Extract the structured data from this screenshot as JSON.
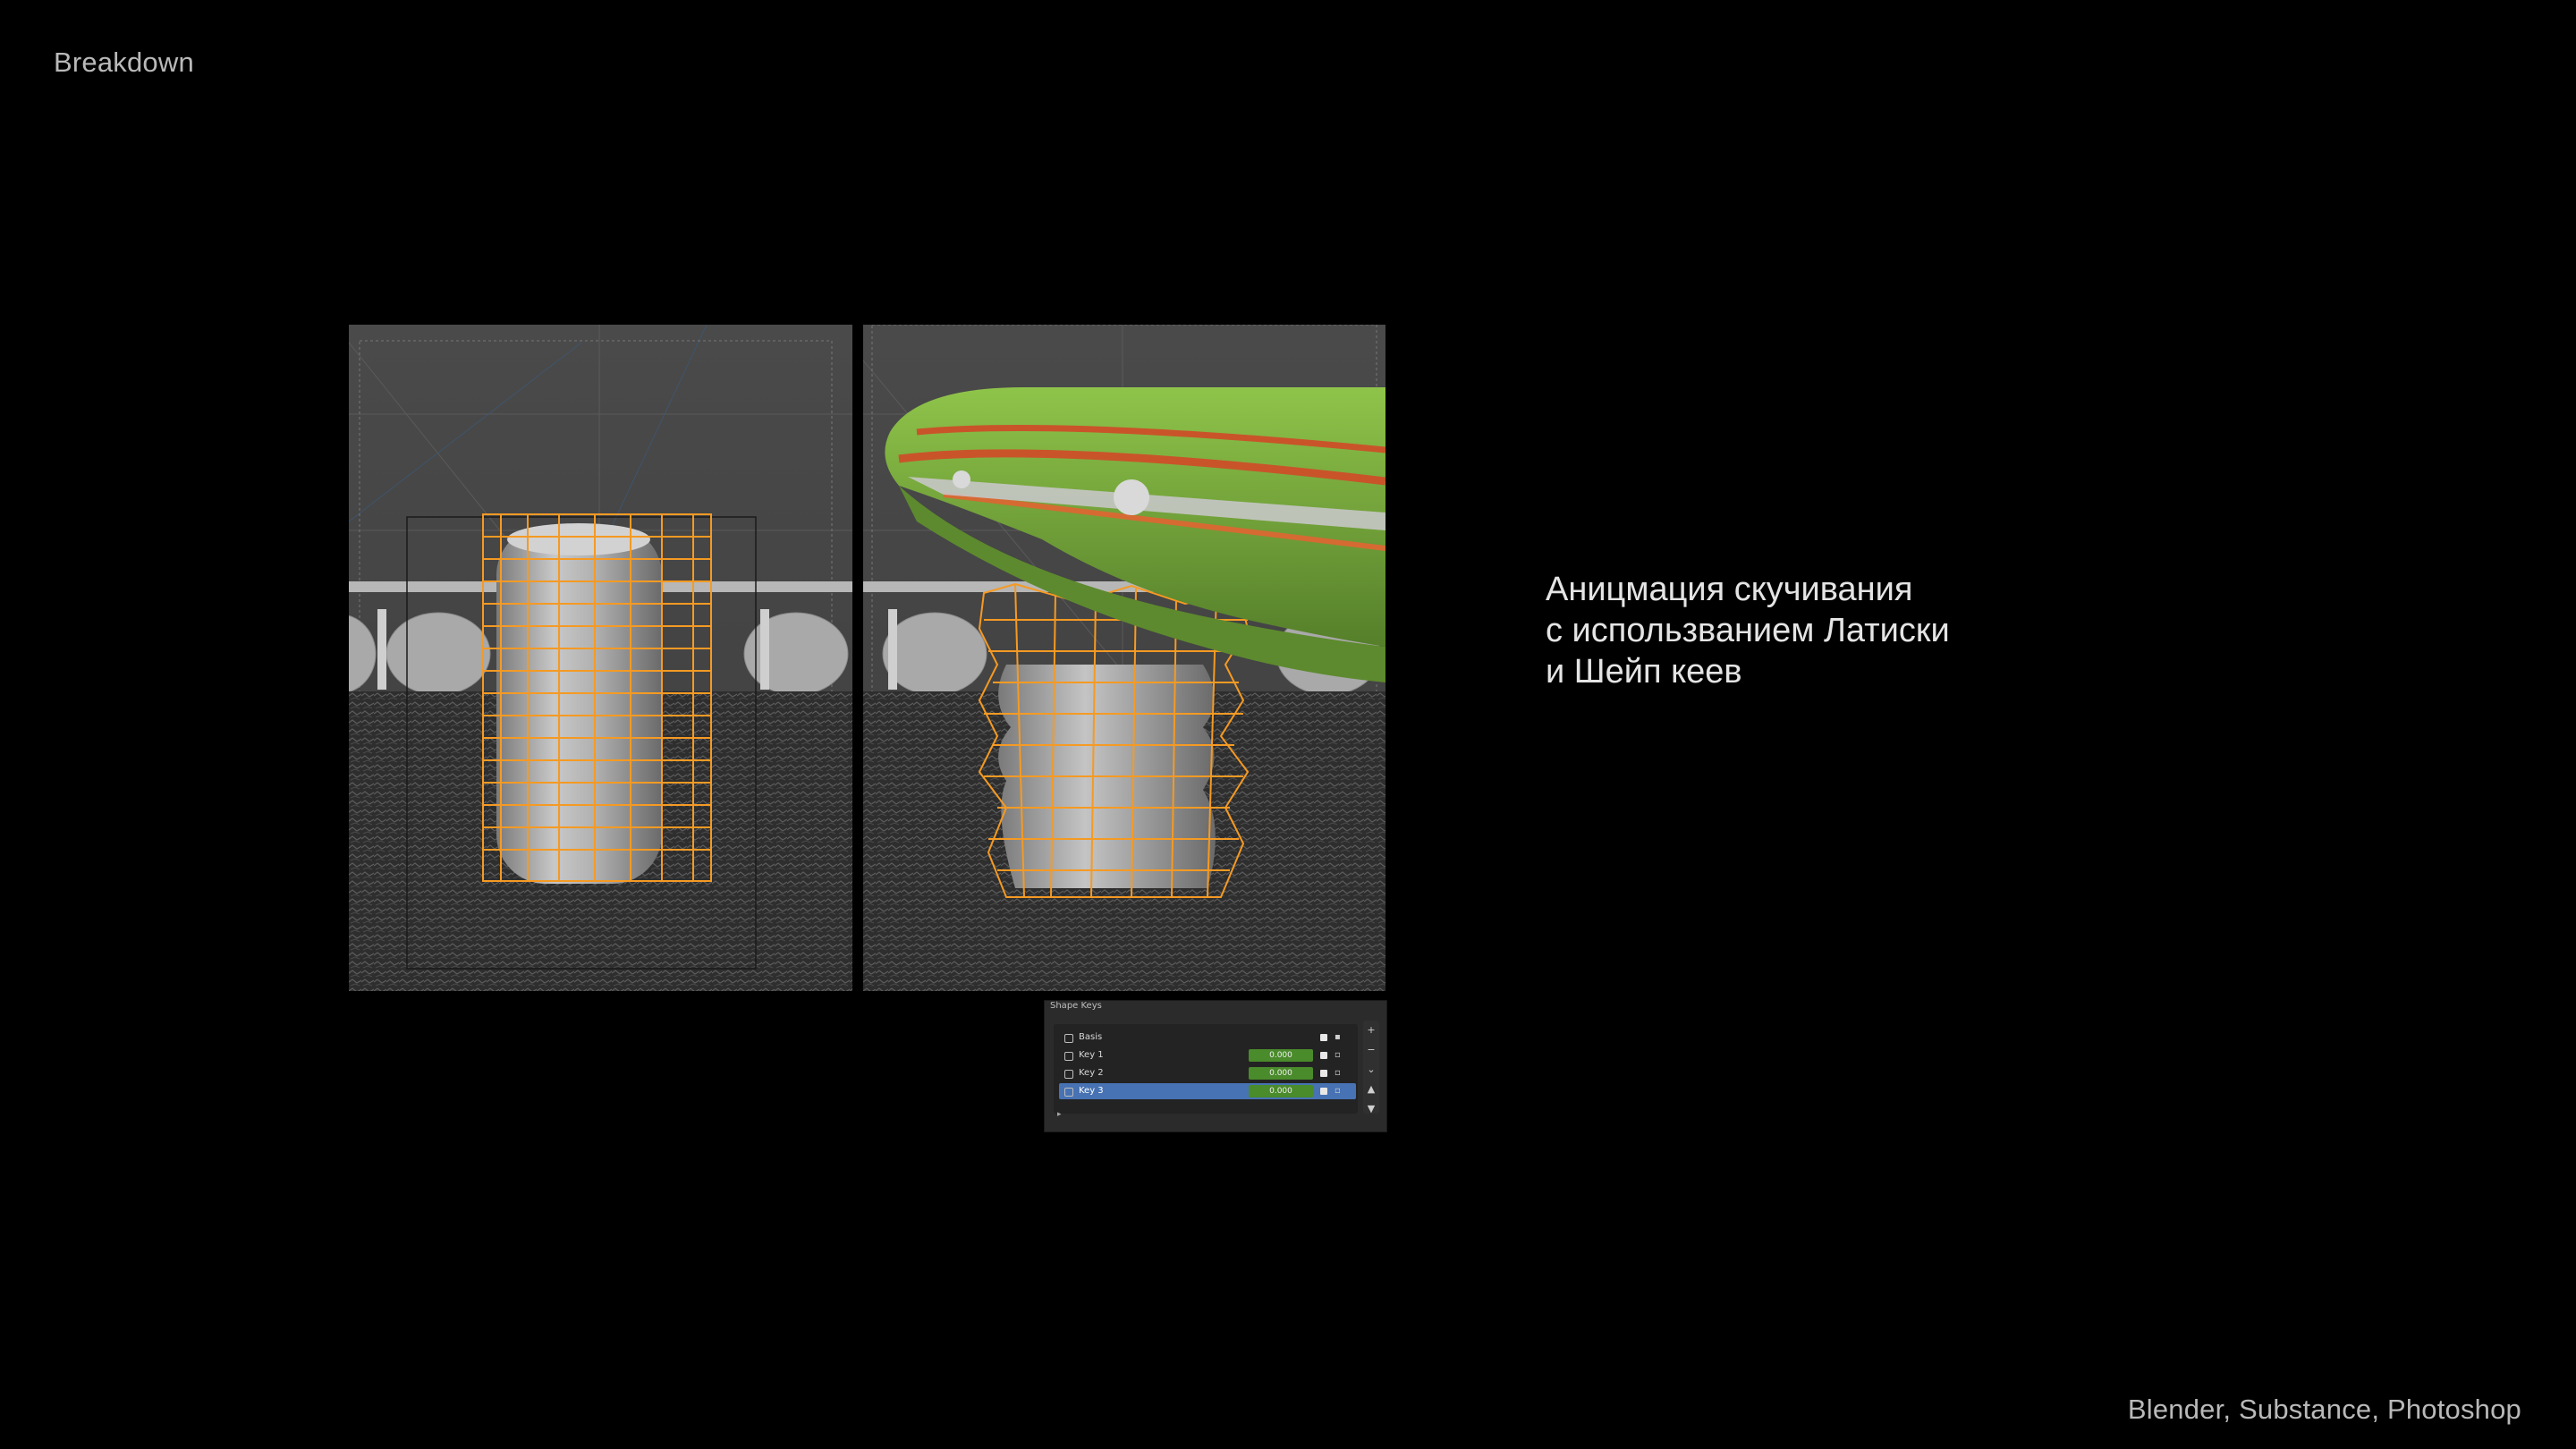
{
  "page": {
    "section_title": "Breakdown",
    "tools": "Blender, Substance, Photoshop"
  },
  "description": {
    "line1": "Аницмация скучивания",
    "line2": "с использванием Латиски",
    "line3": "и Шейп кеев"
  },
  "shape_keys": {
    "header": "Shape Keys",
    "rows": [
      {
        "name": "Basis",
        "value": ""
      },
      {
        "name": "Key 1",
        "value": "0.000"
      },
      {
        "name": "Key 2",
        "value": "0.000"
      },
      {
        "name": "Key 3",
        "value": "0.000"
      }
    ],
    "active_index": 3,
    "side_buttons": [
      "+",
      "−",
      "⌄",
      "▲",
      "▼"
    ],
    "footer": "▸"
  },
  "colors": {
    "background": "#000000",
    "lattice_orange": "#f59a23",
    "active_row": "#4772b3",
    "value_field": "#4a8b2b",
    "boot_green": "#7bab3d"
  },
  "icons": {
    "lock": "lock-icon",
    "check": "checkbox-icon"
  }
}
